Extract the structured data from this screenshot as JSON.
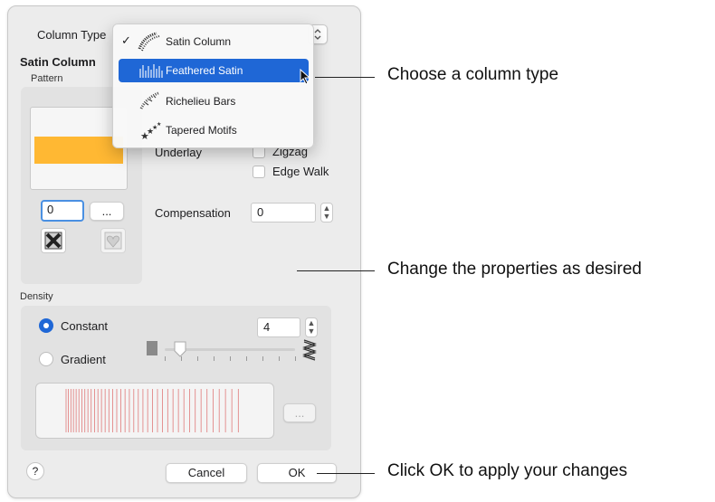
{
  "dialog": {
    "column_type_label": "Column Type",
    "section_title": "Satin Column",
    "pattern_label": "Pattern",
    "pattern_number": "0",
    "browse_button": "...",
    "underlay_label": "Underlay",
    "zigzag_label": "Zigzag",
    "edge_walk_label": "Edge Walk",
    "compensation_label": "Compensation",
    "compensation_value": "0",
    "density_label": "Density",
    "constant_label": "Constant",
    "gradient_label": "Gradient",
    "density_value": "4",
    "density_slider_fraction": 0.12,
    "gradient_browse": "...",
    "help_label": "?",
    "cancel_label": "Cancel",
    "ok_label": "OK",
    "selected_option": "constant",
    "pattern_color": "#ffb833"
  },
  "dropdown": {
    "items": [
      {
        "label": "Satin Column",
        "checked": true,
        "icon": "satin-column-icon"
      },
      {
        "label": "Feathered Satin",
        "highlighted": true,
        "icon": "feathered-satin-icon"
      },
      {
        "label": "Richelieu Bars",
        "icon": "richelieu-bars-icon"
      },
      {
        "label": "Tapered Motifs",
        "icon": "tapered-motifs-icon"
      }
    ],
    "highlight_color": "#1f67d6"
  },
  "callouts": {
    "column_type": "Choose a column type",
    "properties": "Change the properties as desired",
    "ok": "Click OK to apply your changes"
  }
}
